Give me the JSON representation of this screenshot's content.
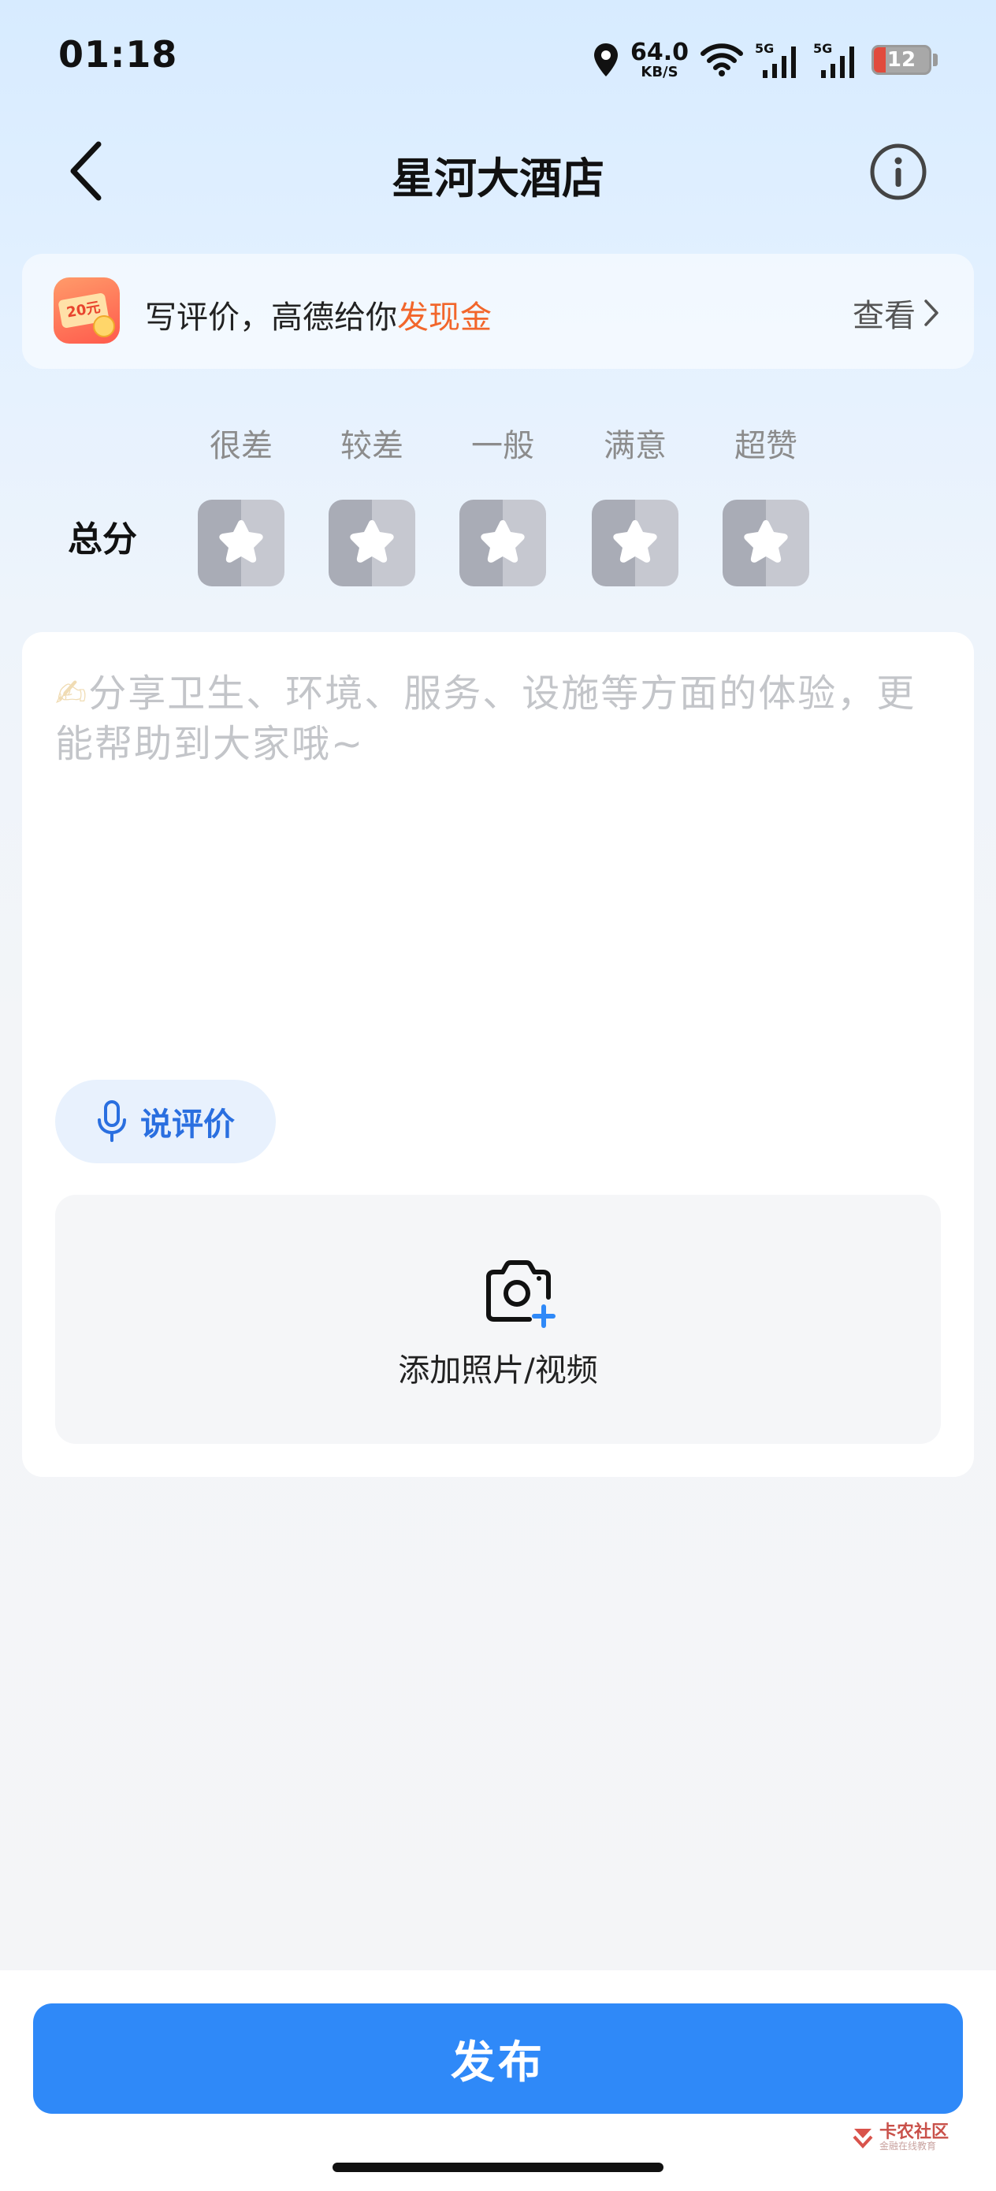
{
  "status_bar": {
    "time": "01:18",
    "net_speed_value": "64.0",
    "net_speed_unit": "KB/S",
    "network_1": "5G",
    "network_2": "5G",
    "battery_level": "12"
  },
  "nav": {
    "title": "星河大酒店"
  },
  "promo": {
    "text_prefix": "写评价，高德给你",
    "text_highlight": "发现金",
    "icon_text": "20元",
    "link_label": "查看"
  },
  "rating": {
    "label": "总分",
    "options": [
      "很差",
      "较差",
      "一般",
      "满意",
      "超赞"
    ],
    "selected_stars": 0
  },
  "review": {
    "placeholder_emoji": "✍",
    "placeholder": "分享卫生、环境、服务、设施等方面的体验，更能帮助到大家哦~",
    "voice_label": "说评价",
    "upload_label": "添加照片/视频"
  },
  "footer": {
    "publish_label": "发布",
    "watermark": "卡农社区",
    "watermark_sub": "金融在线教育"
  },
  "colors": {
    "accent": "#2f89f8",
    "highlight": "#f2662b",
    "voice_text": "#2a6fe0"
  }
}
